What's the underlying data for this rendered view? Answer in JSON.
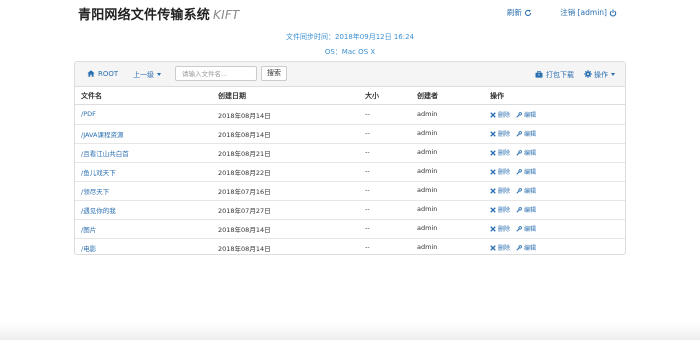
{
  "header": {
    "brand": "青阳网络文件传输系统",
    "brand_en": "KIFT",
    "refresh_label": "刷新",
    "logout_label": "注销 [admin]"
  },
  "info": {
    "sync_time": "文件同步时间：2018年09月12日 16:24",
    "os": "OS：Mac OS X"
  },
  "toolbar": {
    "root_label": "ROOT",
    "up_label": "上一级",
    "search_placeholder": "请输入文件名...",
    "search_button": "搜索",
    "pack_label": "打包下载",
    "ops_label": "操作"
  },
  "table": {
    "headers": [
      "文件名",
      "创建日期",
      "大小",
      "创建者",
      "操作"
    ],
    "op_delete": "删除",
    "op_edit": "编辑",
    "rows": [
      {
        "name": "/PDF",
        "date": "2018年08月14日",
        "size": "--",
        "creator": "admin"
      },
      {
        "name": "/JAVA课程资源",
        "date": "2018年08月14日",
        "size": "--",
        "creator": "admin"
      },
      {
        "name": "/且看江山共白首",
        "date": "2018年08月21日",
        "size": "--",
        "creator": "admin"
      },
      {
        "name": "/鱼儿戏天下",
        "date": "2018年08月22日",
        "size": "--",
        "creator": "admin"
      },
      {
        "name": "/领尽天下",
        "date": "2018年07月16日",
        "size": "--",
        "creator": "admin"
      },
      {
        "name": "/遇见你的我",
        "date": "2018年07月27日",
        "size": "--",
        "creator": "admin"
      },
      {
        "name": "/图片",
        "date": "2018年08月14日",
        "size": "--",
        "creator": "admin"
      },
      {
        "name": "/电影",
        "date": "2018年08月14日",
        "size": "--",
        "creator": "admin"
      }
    ]
  },
  "colors": {
    "link": "#2a6fb0",
    "info": "#3a8fd1",
    "toolbar_bg": "#f5f5f5",
    "border": "#dddddd"
  },
  "icons": {
    "refresh": "refresh-icon",
    "logout": "power-icon",
    "root": "home-icon",
    "pack": "briefcase-icon",
    "ops": "gear-icon",
    "delete": "remove-icon",
    "edit": "wrench-icon"
  }
}
